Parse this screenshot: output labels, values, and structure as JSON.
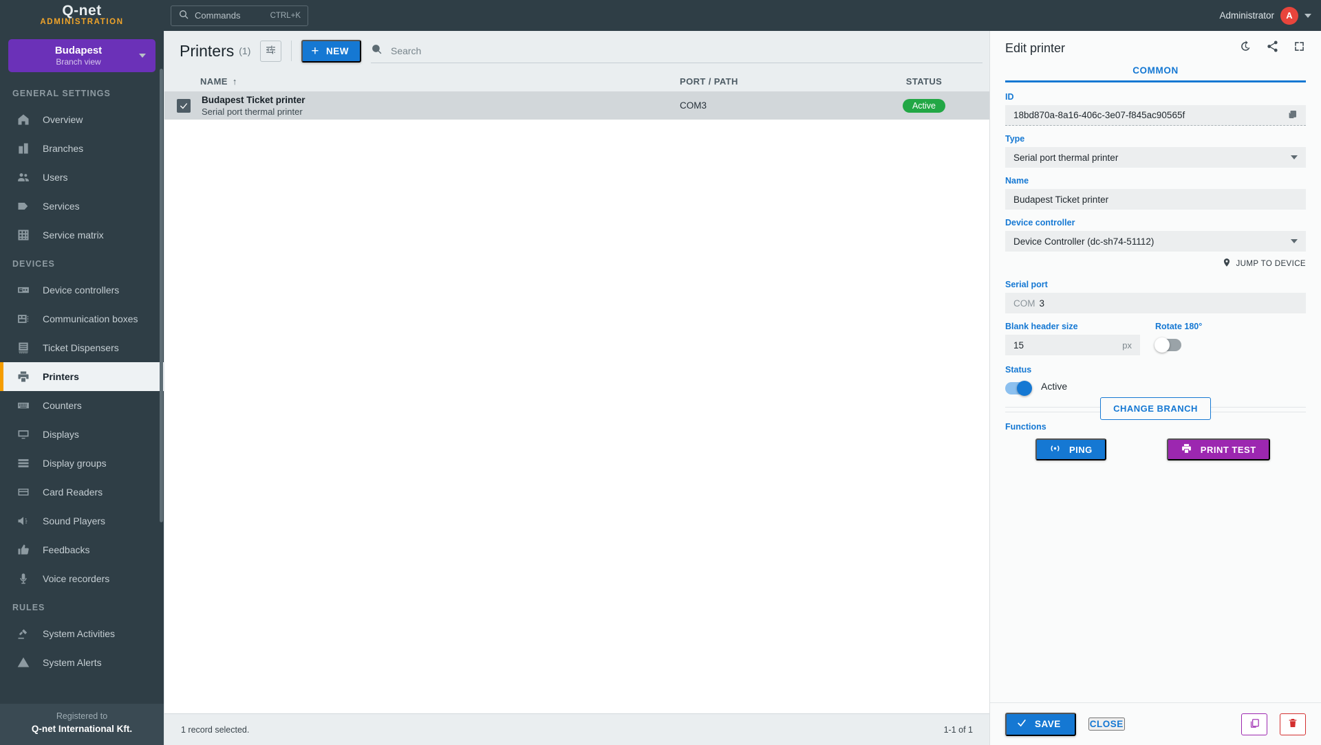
{
  "topbar": {
    "logo": "Q-net",
    "logo_sub": "ADMINISTRATION",
    "commands_label": "Commands",
    "commands_shortcut": "CTRL+K",
    "user_name": "Administrator",
    "avatar_initial": "A"
  },
  "sidebar": {
    "branch": {
      "name": "Budapest",
      "subtitle": "Branch view"
    },
    "groups": [
      {
        "title": "GENERAL SETTINGS",
        "items": [
          {
            "label": "Overview",
            "icon": "home-icon",
            "active": false
          },
          {
            "label": "Branches",
            "icon": "building-icon",
            "active": false
          },
          {
            "label": "Users",
            "icon": "users-icon",
            "active": false
          },
          {
            "label": "Services",
            "icon": "tag-icon",
            "active": false
          },
          {
            "label": "Service matrix",
            "icon": "grid-icon",
            "active": false
          }
        ]
      },
      {
        "title": "DEVICES",
        "items": [
          {
            "label": "Device controllers",
            "icon": "device-controller-icon",
            "active": false
          },
          {
            "label": "Communication boxes",
            "icon": "comm-box-icon",
            "active": false
          },
          {
            "label": "Ticket Dispensers",
            "icon": "ticket-dispenser-icon",
            "active": false
          },
          {
            "label": "Printers",
            "icon": "printer-icon",
            "active": true
          },
          {
            "label": "Counters",
            "icon": "counter-icon",
            "active": false
          },
          {
            "label": "Displays",
            "icon": "display-icon",
            "active": false
          },
          {
            "label": "Display groups",
            "icon": "display-group-icon",
            "active": false
          },
          {
            "label": "Card Readers",
            "icon": "card-reader-icon",
            "active": false
          },
          {
            "label": "Sound Players",
            "icon": "speaker-icon",
            "active": false
          },
          {
            "label": "Feedbacks",
            "icon": "thumbs-up-icon",
            "active": false
          },
          {
            "label": "Voice recorders",
            "icon": "microphone-icon",
            "active": false
          }
        ]
      },
      {
        "title": "RULES",
        "items": [
          {
            "label": "System Activities",
            "icon": "gavel-icon",
            "active": false
          },
          {
            "label": "System Alerts",
            "icon": "warning-icon",
            "active": false
          }
        ]
      }
    ],
    "registered_label": "Registered to",
    "registered_company": "Q-net International Kft."
  },
  "main": {
    "title": "Printers",
    "count": "(1)",
    "new_label": "NEW",
    "new_plus": "+",
    "search_placeholder": "Search",
    "search_value": "",
    "columns": {
      "name": "NAME",
      "sort": "↑",
      "port": "PORT / PATH",
      "status": "STATUS"
    },
    "rows": [
      {
        "name": "Budapest Ticket printer",
        "subtitle": "Serial port thermal printer",
        "port": "COM3",
        "status": "Active",
        "status_color": "#22a745",
        "selected": true
      }
    ],
    "footer_left": "1 record selected.",
    "footer_right": "1-1 of 1"
  },
  "panel": {
    "title": "Edit printer",
    "tab": "COMMON",
    "id_label": "ID",
    "id_value": "18bd870a-8a16-406c-3e07-f845ac90565f",
    "type_label": "Type",
    "type_value": "Serial port thermal printer",
    "name_label": "Name",
    "name_value": "Budapest Ticket printer",
    "device_controller_label": "Device controller",
    "device_controller_value": "Device Controller (dc-sh74-51112)",
    "jump_to_device": "JUMP TO DEVICE",
    "serial_port_label": "Serial port",
    "serial_port_prefix": "COM",
    "serial_port_value": "3",
    "blank_header_label": "Blank header size",
    "blank_header_value": "15",
    "blank_header_unit": "px",
    "rotate_label": "Rotate 180°",
    "rotate_on": false,
    "status_label": "Status",
    "status_value": "Active",
    "status_on": true,
    "change_branch": "CHANGE BRANCH",
    "functions_label": "Functions",
    "ping_label": "PING",
    "print_test_label": "PRINT TEST",
    "save_label": "SAVE",
    "close_label": "CLOSE"
  },
  "colors": {
    "accent_blue": "#1578d3",
    "brand_purple": "#6b31b8",
    "sidebar_bg": "#2f3e46",
    "active_orange": "#f59d00",
    "status_green": "#22a745",
    "magenta": "#9c27b0",
    "danger_red": "#d32f2f"
  }
}
